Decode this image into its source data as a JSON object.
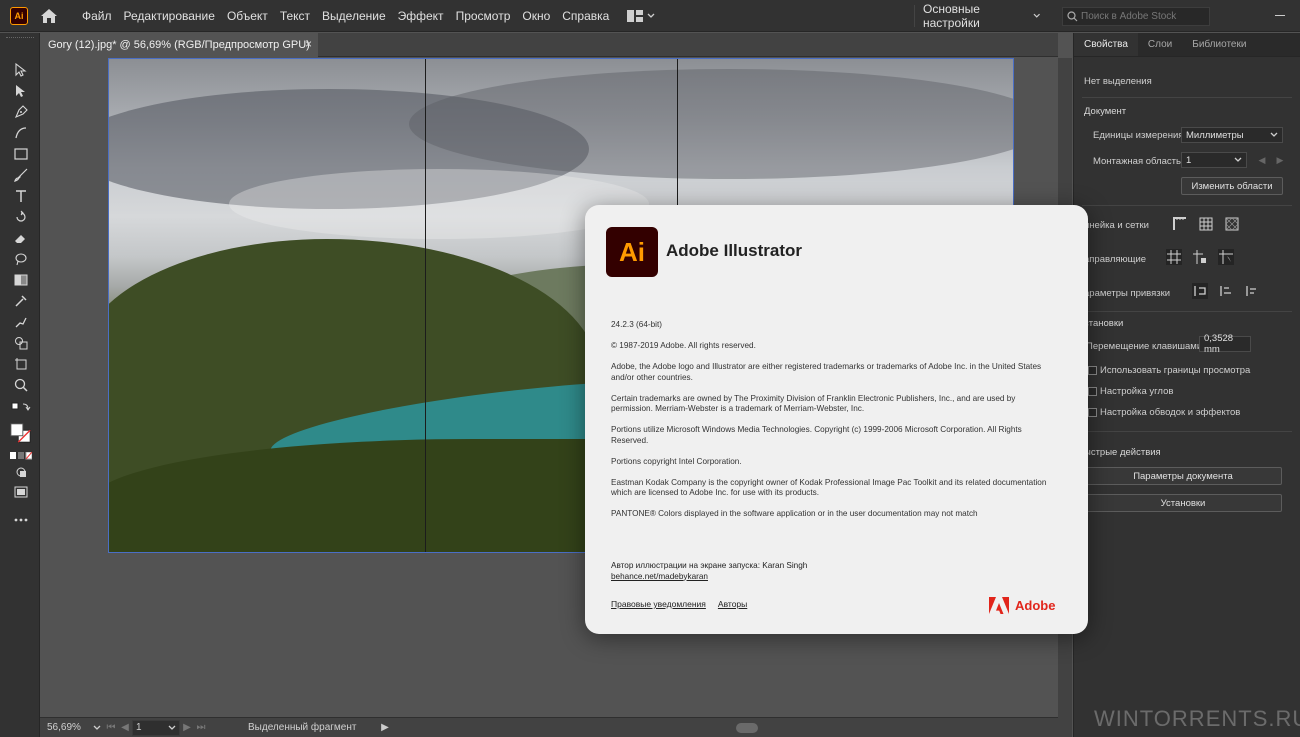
{
  "app": {
    "logo_text": "Ai",
    "menu": [
      "Файл",
      "Редактирование",
      "Объект",
      "Текст",
      "Выделение",
      "Эффект",
      "Просмотр",
      "Окно",
      "Справка"
    ],
    "workspace": "Основные настройки",
    "search_placeholder": "Поиск в Adobe Stock"
  },
  "document_tab": {
    "title": "Gory (12).jpg* @ 56,69% (RGB/Предпросмотр GPU)",
    "close": "×"
  },
  "status": {
    "zoom": "56,69%",
    "page": "1",
    "selection_text": "Выделенный фрагмент"
  },
  "properties_panel": {
    "tabs": [
      "Свойства",
      "Слои",
      "Библиотеки"
    ],
    "no_selection": "Нет выделения",
    "document_header": "Документ",
    "units_label": "Единицы измерения:",
    "units_value": "Миллиметры",
    "artboard_label": "Монтажная область:",
    "artboard_value": "1",
    "edit_artboards": "Изменить области",
    "rulers_grids": "инейка и сетки",
    "guides": "аправляющие",
    "snap_options": "араметры привязки",
    "preferences_header": "становки",
    "keyboard_increment_label": "Перемещение клавишами:",
    "keyboard_increment_value": "0,3528 mm",
    "use_preview_bounds": "Использовать границы просмотра",
    "scale_corners": "Настройка углов",
    "scale_strokes": "Настройка обводок и эффектов",
    "quick_actions_header": "ыстрые действия",
    "document_setup": "Параметры документа",
    "preferences_button": "Установки"
  },
  "about_dialog": {
    "logo_text": "Ai",
    "title": "Adobe Illustrator",
    "version": "24.2.3 (64-bit)",
    "copyright": "© 1987-2019 Adobe. All rights reserved.",
    "paragraphs": [
      "Adobe, the Adobe logo and Illustrator are either registered trademarks or trademarks of Adobe Inc. in the United States and/or other countries.",
      "Certain trademarks are owned by The Proximity Division of Franklin Electronic Publishers, Inc., and are used by permission. Merriam-Webster is a trademark of Merriam-Webster, Inc.",
      "Portions utilize Microsoft Windows Media Technologies. Copyright (c) 1999-2006 Microsoft Corporation. All Rights Reserved.",
      "Portions copyright Intel Corporation.",
      "Eastman Kodak Company is the copyright owner of Kodak Professional Image Pac Toolkit and its related documentation which are licensed to Adobe Inc. for use with its products.",
      "PANTONE® Colors displayed in the software application or in the user documentation may not match"
    ],
    "credit_line": "Автор иллюстрации на экране запуска: Karan Singh",
    "credit_link": "behance.net/madebykaran",
    "legal_link": "Правовые уведомления",
    "authors_link": "Авторы",
    "brand": "Adobe"
  },
  "watermark": "WINTORRENTS.RU",
  "colors": {
    "accent": "#ff9a00",
    "ai_bg": "#330000",
    "adobe_red": "#e1251b"
  }
}
